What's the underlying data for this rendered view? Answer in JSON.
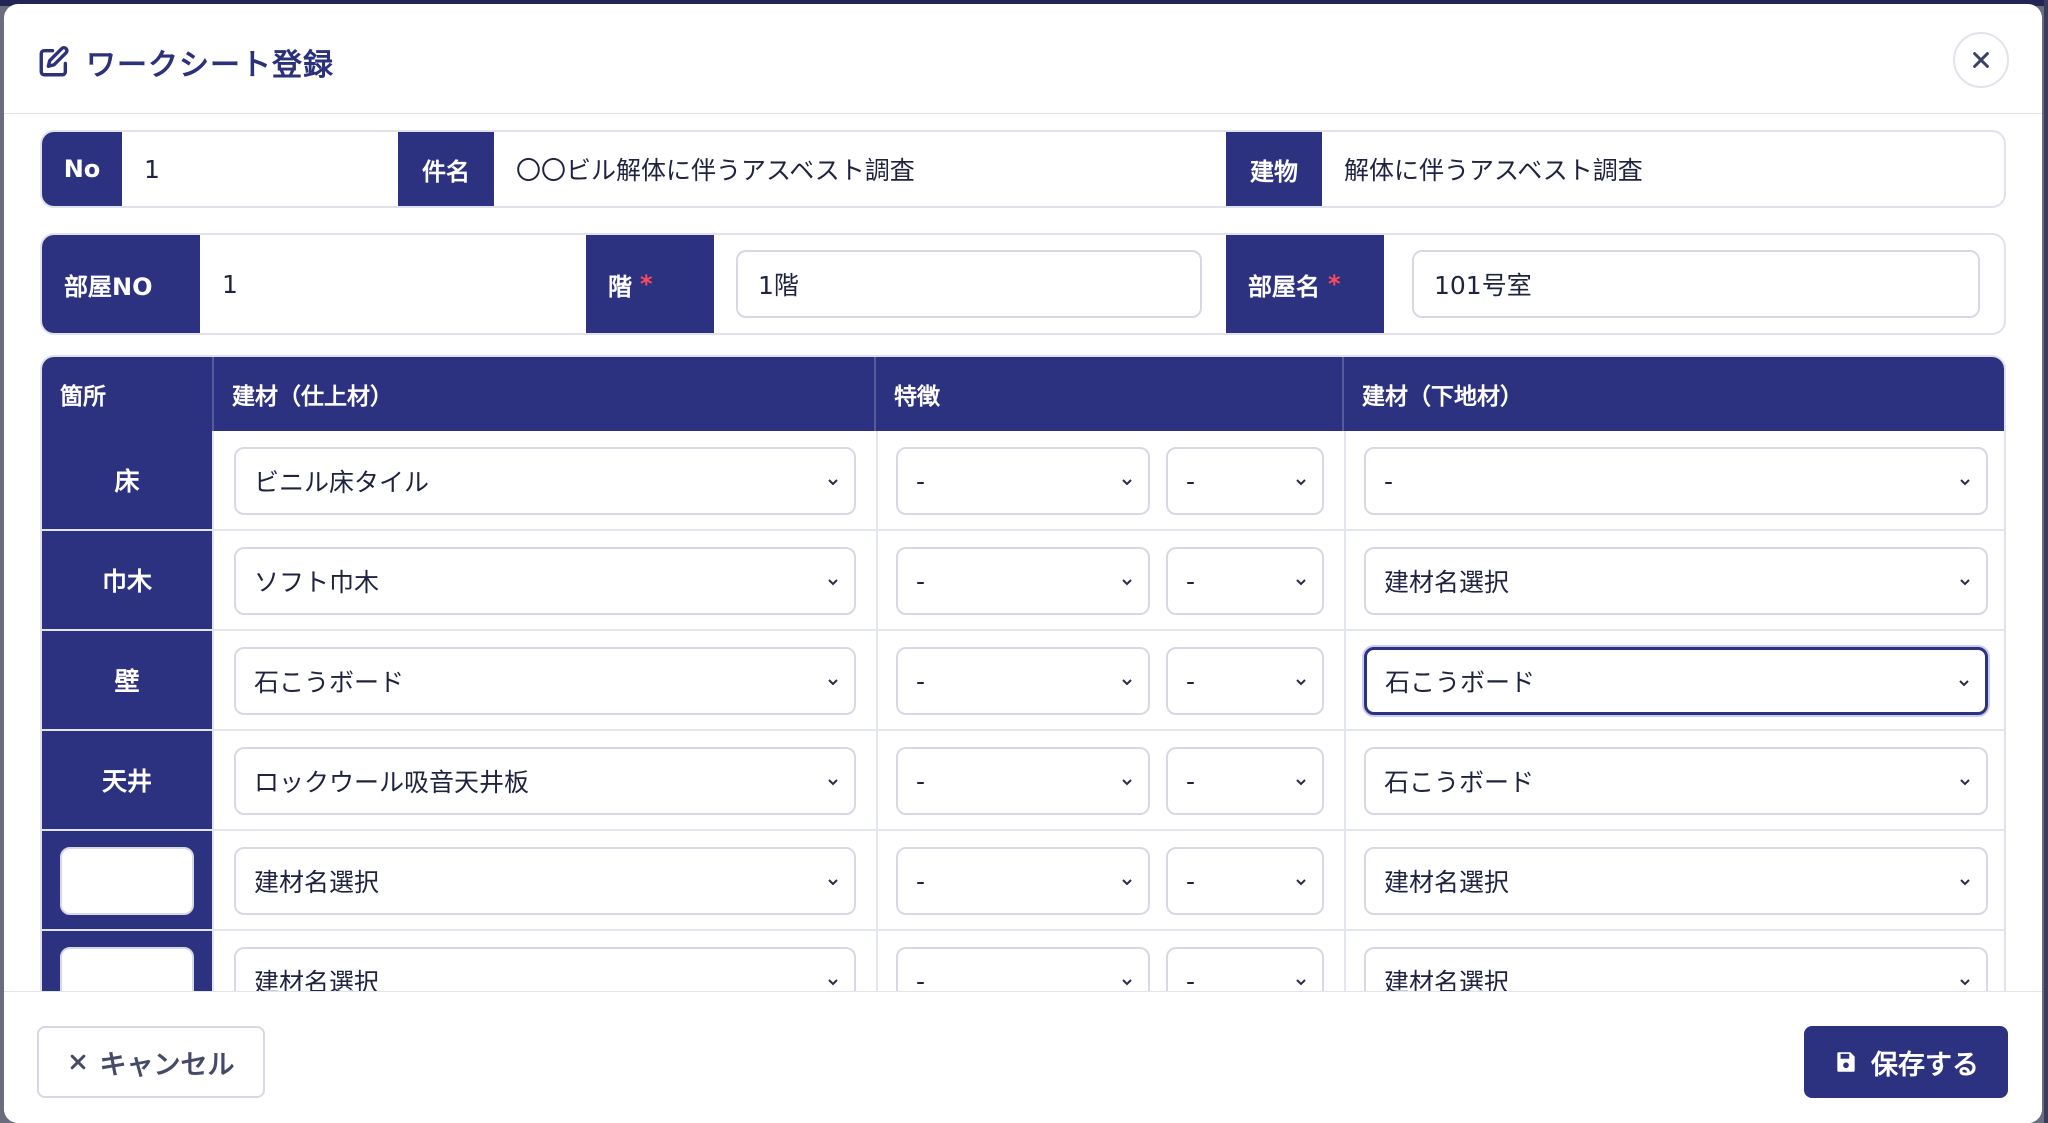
{
  "dialog": {
    "title": "ワークシート登録",
    "icon": "edit-icon"
  },
  "info": {
    "no_label": "No",
    "no_value": "1",
    "subject_label": "件名",
    "subject_value": "〇〇ビル解体に伴うアスベスト調査",
    "building_label": "建物",
    "building_value": "解体に伴うアスベスト調査",
    "room_no_label": "部屋NO",
    "room_no_value": "1",
    "floor_label": "階",
    "floor_value": "1階",
    "room_name_label": "部屋名",
    "room_name_value": "101号室",
    "required_mark": "*"
  },
  "table": {
    "headers": {
      "location": "箇所",
      "finish_material": "建材（仕上材）",
      "feature": "特徴",
      "base_material": "建材（下地材）"
    },
    "rows": [
      {
        "location": "床",
        "finish": "ビニル床タイル",
        "feature1": "-",
        "feature2": "-",
        "base": "-"
      },
      {
        "location": "巾木",
        "finish": "ソフト巾木",
        "feature1": "-",
        "feature2": "-",
        "base": "建材名選択"
      },
      {
        "location": "壁",
        "finish": "石こうボード",
        "feature1": "-",
        "feature2": "-",
        "base": "石こうボード"
      },
      {
        "location": "天井",
        "finish": "ロックウール吸音天井板",
        "feature1": "-",
        "feature2": "-",
        "base": "石こうボード"
      },
      {
        "location": "",
        "finish": "建材名選択",
        "feature1": "-",
        "feature2": "-",
        "base": "建材名選択"
      },
      {
        "location": "",
        "finish": "建材名選択",
        "feature1": "-",
        "feature2": "-",
        "base": "建材名選択"
      }
    ]
  },
  "footer": {
    "cancel_label": "キャンセル",
    "save_label": "保存する"
  },
  "colors": {
    "primary": "#2d3280",
    "required": "#ff4a5c"
  }
}
